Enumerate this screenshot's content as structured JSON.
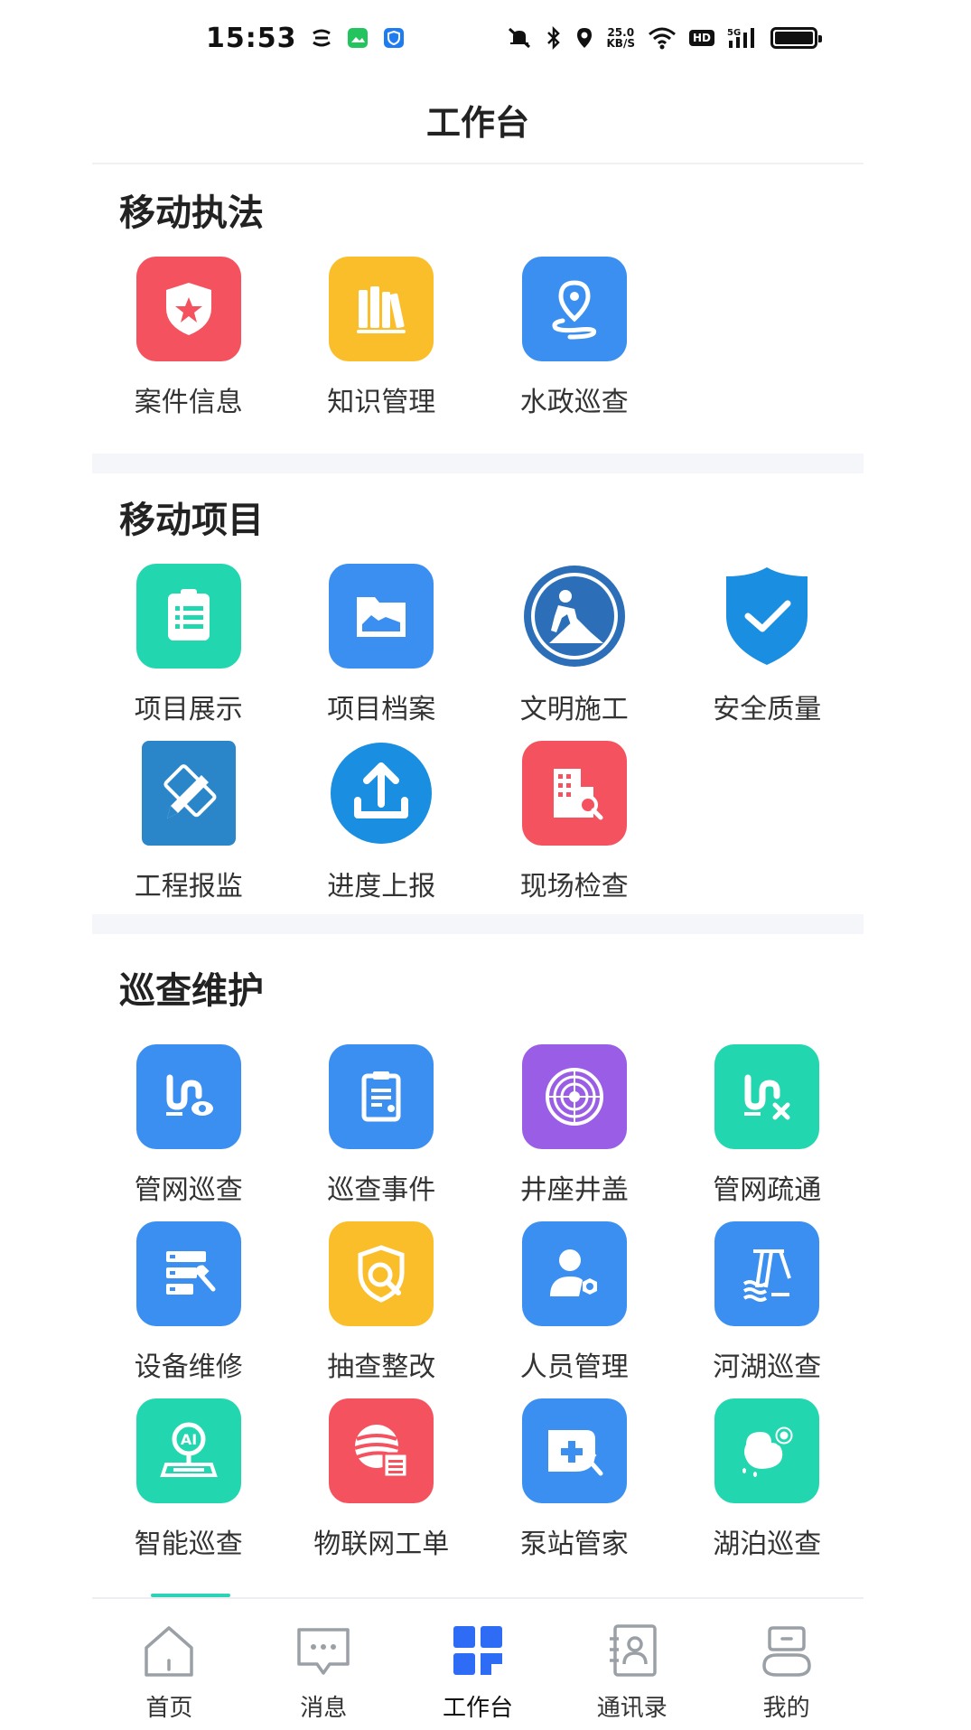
{
  "status_bar": {
    "time": "15:53",
    "net_speed_value": "25.0",
    "net_speed_unit": "KB/S",
    "hd_label": "HD",
    "signal_label": "5G"
  },
  "header": {
    "title": "工作台"
  },
  "sections": [
    {
      "title": "移动执法",
      "items": [
        {
          "label": "案件信息",
          "icon": "shield-star-icon",
          "color": "#f5525f"
        },
        {
          "label": "知识管理",
          "icon": "books-icon",
          "color": "#fbbe2b"
        },
        {
          "label": "水政巡查",
          "icon": "location-route-icon",
          "color": "#3a8ff0"
        }
      ]
    },
    {
      "title": "移动项目",
      "items": [
        {
          "label": "项目展示",
          "icon": "clipboard-list-icon",
          "color": "#22d6b0"
        },
        {
          "label": "项目档案",
          "icon": "folder-icon",
          "color": "#3a8ff0"
        },
        {
          "label": "文明施工",
          "icon": "construction-worker-icon",
          "color": "#2c6fb8"
        },
        {
          "label": "安全质量",
          "icon": "shield-check-icon",
          "color": "#1a8ee0"
        },
        {
          "label": "工程报监",
          "icon": "pencil-ruler-icon",
          "color": "#2a86c8"
        },
        {
          "label": "进度上报",
          "icon": "upload-icon",
          "color": "#1a8ee0"
        },
        {
          "label": "现场检查",
          "icon": "building-search-icon",
          "color": "#f5525f"
        }
      ]
    },
    {
      "title": "巡查维护",
      "items": [
        {
          "label": "管网巡查",
          "icon": "pipe-eye-icon",
          "color": "#3a8ff0"
        },
        {
          "label": "巡查事件",
          "icon": "clipboard-doc-icon",
          "color": "#3a8ff0"
        },
        {
          "label": "井座井盖",
          "icon": "manhole-cover-icon",
          "color": "#9a5ee6"
        },
        {
          "label": "管网疏通",
          "icon": "pipe-wrench-icon",
          "color": "#22d6b0"
        },
        {
          "label": "设备维修",
          "icon": "server-wrench-icon",
          "color": "#3a8ff0"
        },
        {
          "label": "抽查整改",
          "icon": "shield-search-icon",
          "color": "#fbbe2b"
        },
        {
          "label": "人员管理",
          "icon": "user-gear-icon",
          "color": "#3a8ff0"
        },
        {
          "label": "河湖巡查",
          "icon": "dam-water-icon",
          "color": "#3a8ff0"
        },
        {
          "label": "智能巡查",
          "icon": "ai-location-icon",
          "color": "#22d6b0"
        },
        {
          "label": "物联网工单",
          "icon": "iot-globe-icon",
          "color": "#f5525f"
        },
        {
          "label": "泵站管家",
          "icon": "pump-station-icon",
          "color": "#3a8ff0"
        },
        {
          "label": "湖泊巡查",
          "icon": "lake-bubble-icon",
          "color": "#22d6b0"
        }
      ]
    }
  ],
  "tab_bar": {
    "tabs": [
      {
        "label": "首页",
        "icon": "home-icon"
      },
      {
        "label": "消息",
        "icon": "message-icon"
      },
      {
        "label": "工作台",
        "icon": "workbench-icon",
        "active": true
      },
      {
        "label": "通讯录",
        "icon": "contacts-icon"
      },
      {
        "label": "我的",
        "icon": "profile-icon"
      }
    ],
    "active_color": "#2f6cf5",
    "inactive_color": "#9aa0a6"
  }
}
